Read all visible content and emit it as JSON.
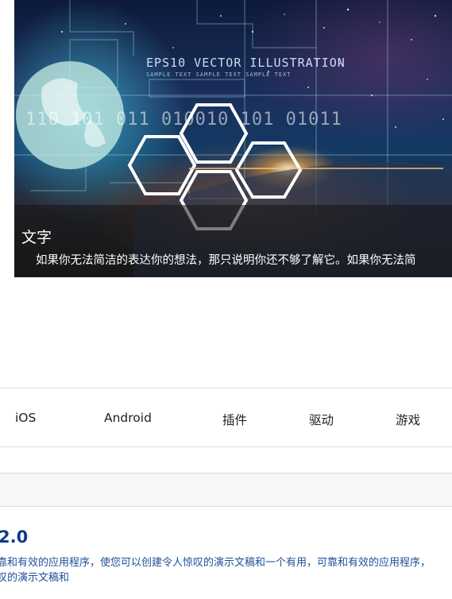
{
  "banner": {
    "art_title": "EPS10 VECTOR ILLUSTRATION",
    "art_subtitle": "SAMPLE TEXT SAMPLE TEXT SAMPLE TEXT",
    "art_digits": "110 101 011 010010 101 01011",
    "caption_title": "文字",
    "caption_text": "如果你无法简洁的表达你的想法，那只说明你还不够了解它。如果你无法简"
  },
  "nav": {
    "items": [
      {
        "label": "iOS"
      },
      {
        "label": "Android"
      },
      {
        "label": "插件"
      },
      {
        "label": "驱动"
      },
      {
        "label": "游戏"
      }
    ]
  },
  "app": {
    "version_heading": "2.0",
    "description_line1": "靠和有效的应用程序，使您可以创建令人惊叹的演示文稿和一个有用，可靠和有效的应用程序，",
    "description_line2": "叹的演示文稿和"
  }
}
